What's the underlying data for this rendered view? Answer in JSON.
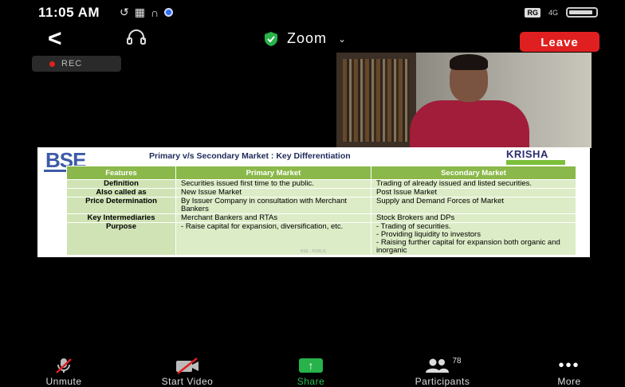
{
  "status_bar": {
    "time": "11:05 AM",
    "left_icons": [
      "sync-icon",
      "image-off-icon",
      "headphones-icon",
      "zoom-dot-icon"
    ],
    "right_icons": [
      "volume-badge-icon",
      "signal-icon",
      "battery-icon"
    ],
    "volume_badge": "RG",
    "signal_text": "4G"
  },
  "header": {
    "title": "Zoom",
    "leave_label": "Leave",
    "back_icon": "<",
    "rec_label": "REC"
  },
  "slide": {
    "logo": "BSE",
    "title": "Primary v/s Secondary Market : Key Differentiation",
    "brand": "KRISHA",
    "columns": [
      "Features",
      "Primary Market",
      "Secondary Market"
    ],
    "rows": [
      {
        "feature": "Definition",
        "primary": "Securities issued first time to the public.",
        "secondary": "Trading of already issued and listed securities."
      },
      {
        "feature": "Also called as",
        "primary": "New Issue Market",
        "secondary": "Post Issue Market"
      },
      {
        "feature": "Price Determination",
        "primary": "By Issuer Company in consultation with Merchant Bankers",
        "secondary": "Supply and Demand Forces of Market"
      },
      {
        "feature": "Key Intermediaries",
        "primary": "Merchant Bankers and RTAs",
        "secondary": "Stock Brokers and DPs"
      }
    ],
    "purpose_row": {
      "feature": "Purpose",
      "primary": [
        "Raise capital for expansion, diversification, etc."
      ],
      "secondary": [
        "Trading of securities.",
        "Providing liquidity to investors",
        "Raising further capital for expansion both organic and inorganic"
      ]
    },
    "footer": "BSE - PUBLIC"
  },
  "toolbar": {
    "unmute": "Unmute",
    "start_video": "Start Video",
    "share": "Share",
    "participants": "Participants",
    "participant_count": "78",
    "more": "More"
  },
  "colors": {
    "leave": "#e02020",
    "share": "#27b24a",
    "table_header": "#8ab84a",
    "table_cell": "#dcecc6"
  }
}
